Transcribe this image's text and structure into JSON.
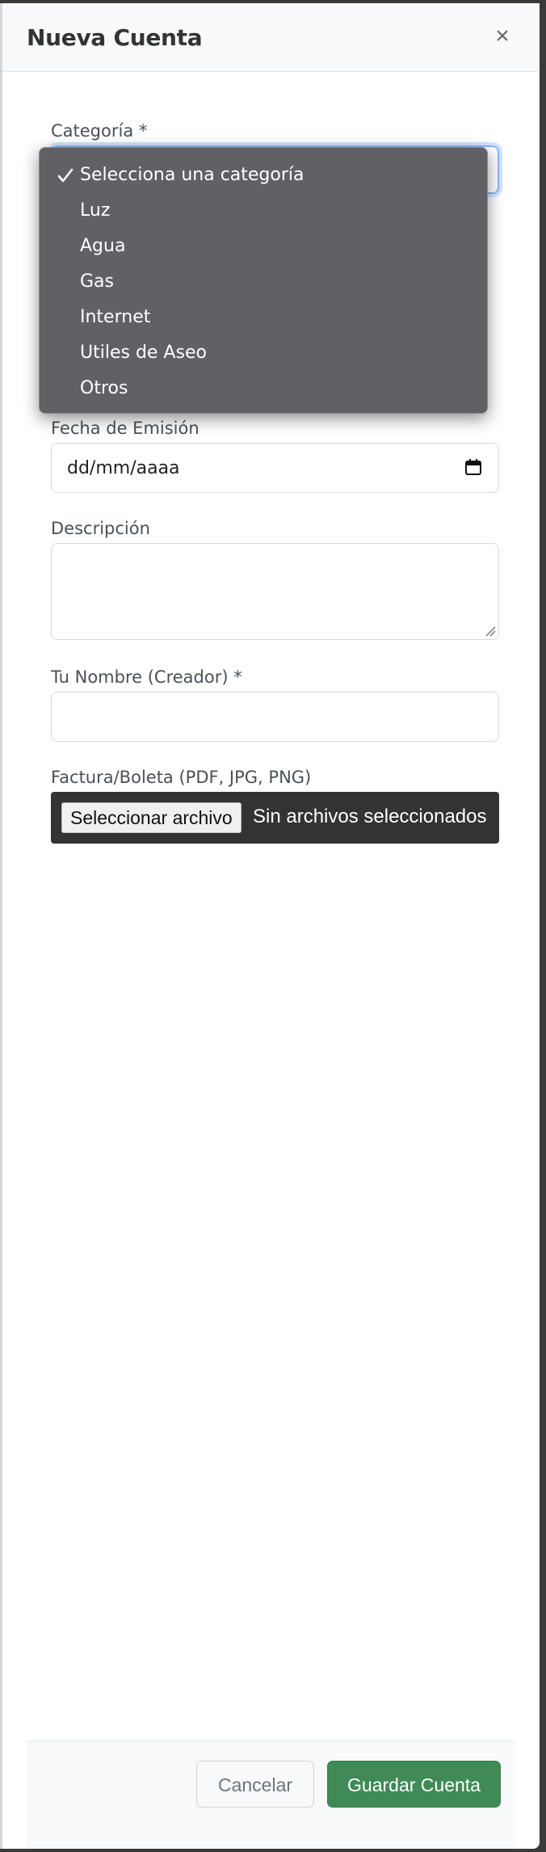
{
  "modal": {
    "title": "Nueva Cuenta",
    "close_glyph": "×"
  },
  "form": {
    "categoria_label": "Categoría *",
    "fecha_label": "Fecha de Emisión",
    "fecha_value": "dd/mm/aaaa",
    "descripcion_label": "Descripción",
    "nombre_label": "Tu Nombre (Creador) *",
    "factura_label": "Factura/Boleta (PDF, JPG, PNG)",
    "file_button": "Seleccionar archivo",
    "file_status": "Sin archivos seleccionados"
  },
  "dropdown": {
    "selected_index": 0,
    "options": [
      "Selecciona una categoría",
      "Luz",
      "Agua",
      "Gas",
      "Internet",
      "Utiles de Aseo",
      "Otros"
    ]
  },
  "footer": {
    "cancel_label": "Cancelar",
    "save_label": "Guardar Cuenta"
  },
  "colors": {
    "primary_save": "#3f8a56",
    "focus_ring": "#86b7fe",
    "dropdown_bg": "#616065"
  },
  "icons": {
    "close": "close-icon",
    "calendar": "calendar-icon",
    "check": "checkmark-icon",
    "resize": "resize-handle-icon"
  }
}
